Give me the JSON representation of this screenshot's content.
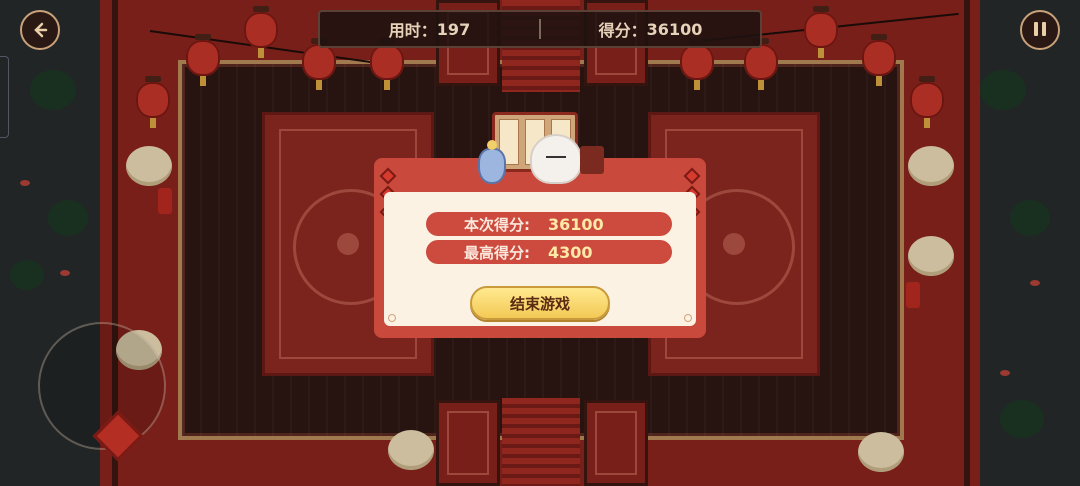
{
  "hud": {
    "time_label": "用时：",
    "time_value": "197",
    "score_label": "得分：",
    "score_value": "36100",
    "back_icon": "back-arrow-icon",
    "pause_icon": "pause-icon"
  },
  "result": {
    "current_score_label": "本次得分:",
    "current_score_value": "36100",
    "best_score_label": "最高得分:",
    "best_score_value": "4300",
    "end_button_label": "结束游戏"
  },
  "colors": {
    "floor": "#8a241d",
    "dialog": "#c9493d",
    "dialog_inner": "#fbf2e4",
    "button": "#f3c955"
  }
}
